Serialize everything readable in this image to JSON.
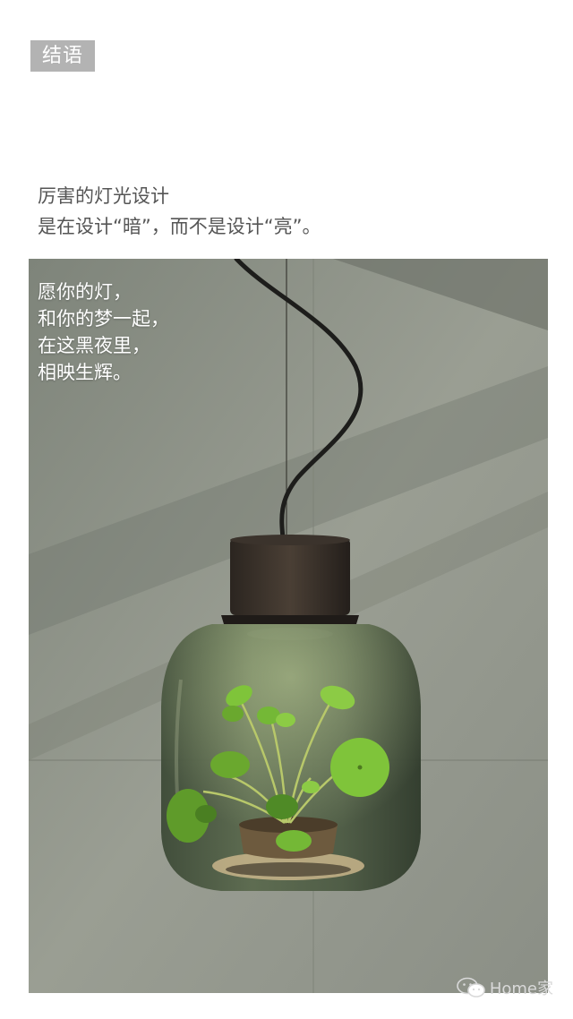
{
  "section": {
    "tag": "结语"
  },
  "intro": {
    "line1": "厉害的灯光设计",
    "line2": "是在设计“暗”，而不是设计“亮”。"
  },
  "photo": {
    "poem": [
      "愿你的灯，",
      "和你的梦一起，",
      "在这黑夜里，",
      "相映生辉。"
    ]
  },
  "watermark": {
    "text": "Home家",
    "icon": "wechat-icon"
  },
  "colors": {
    "tag_bg": "#b3b3b3",
    "intro_text": "#555555",
    "wall": "#8a8f85",
    "glass": "#4d5a44",
    "leaf": "#7fc43a"
  }
}
